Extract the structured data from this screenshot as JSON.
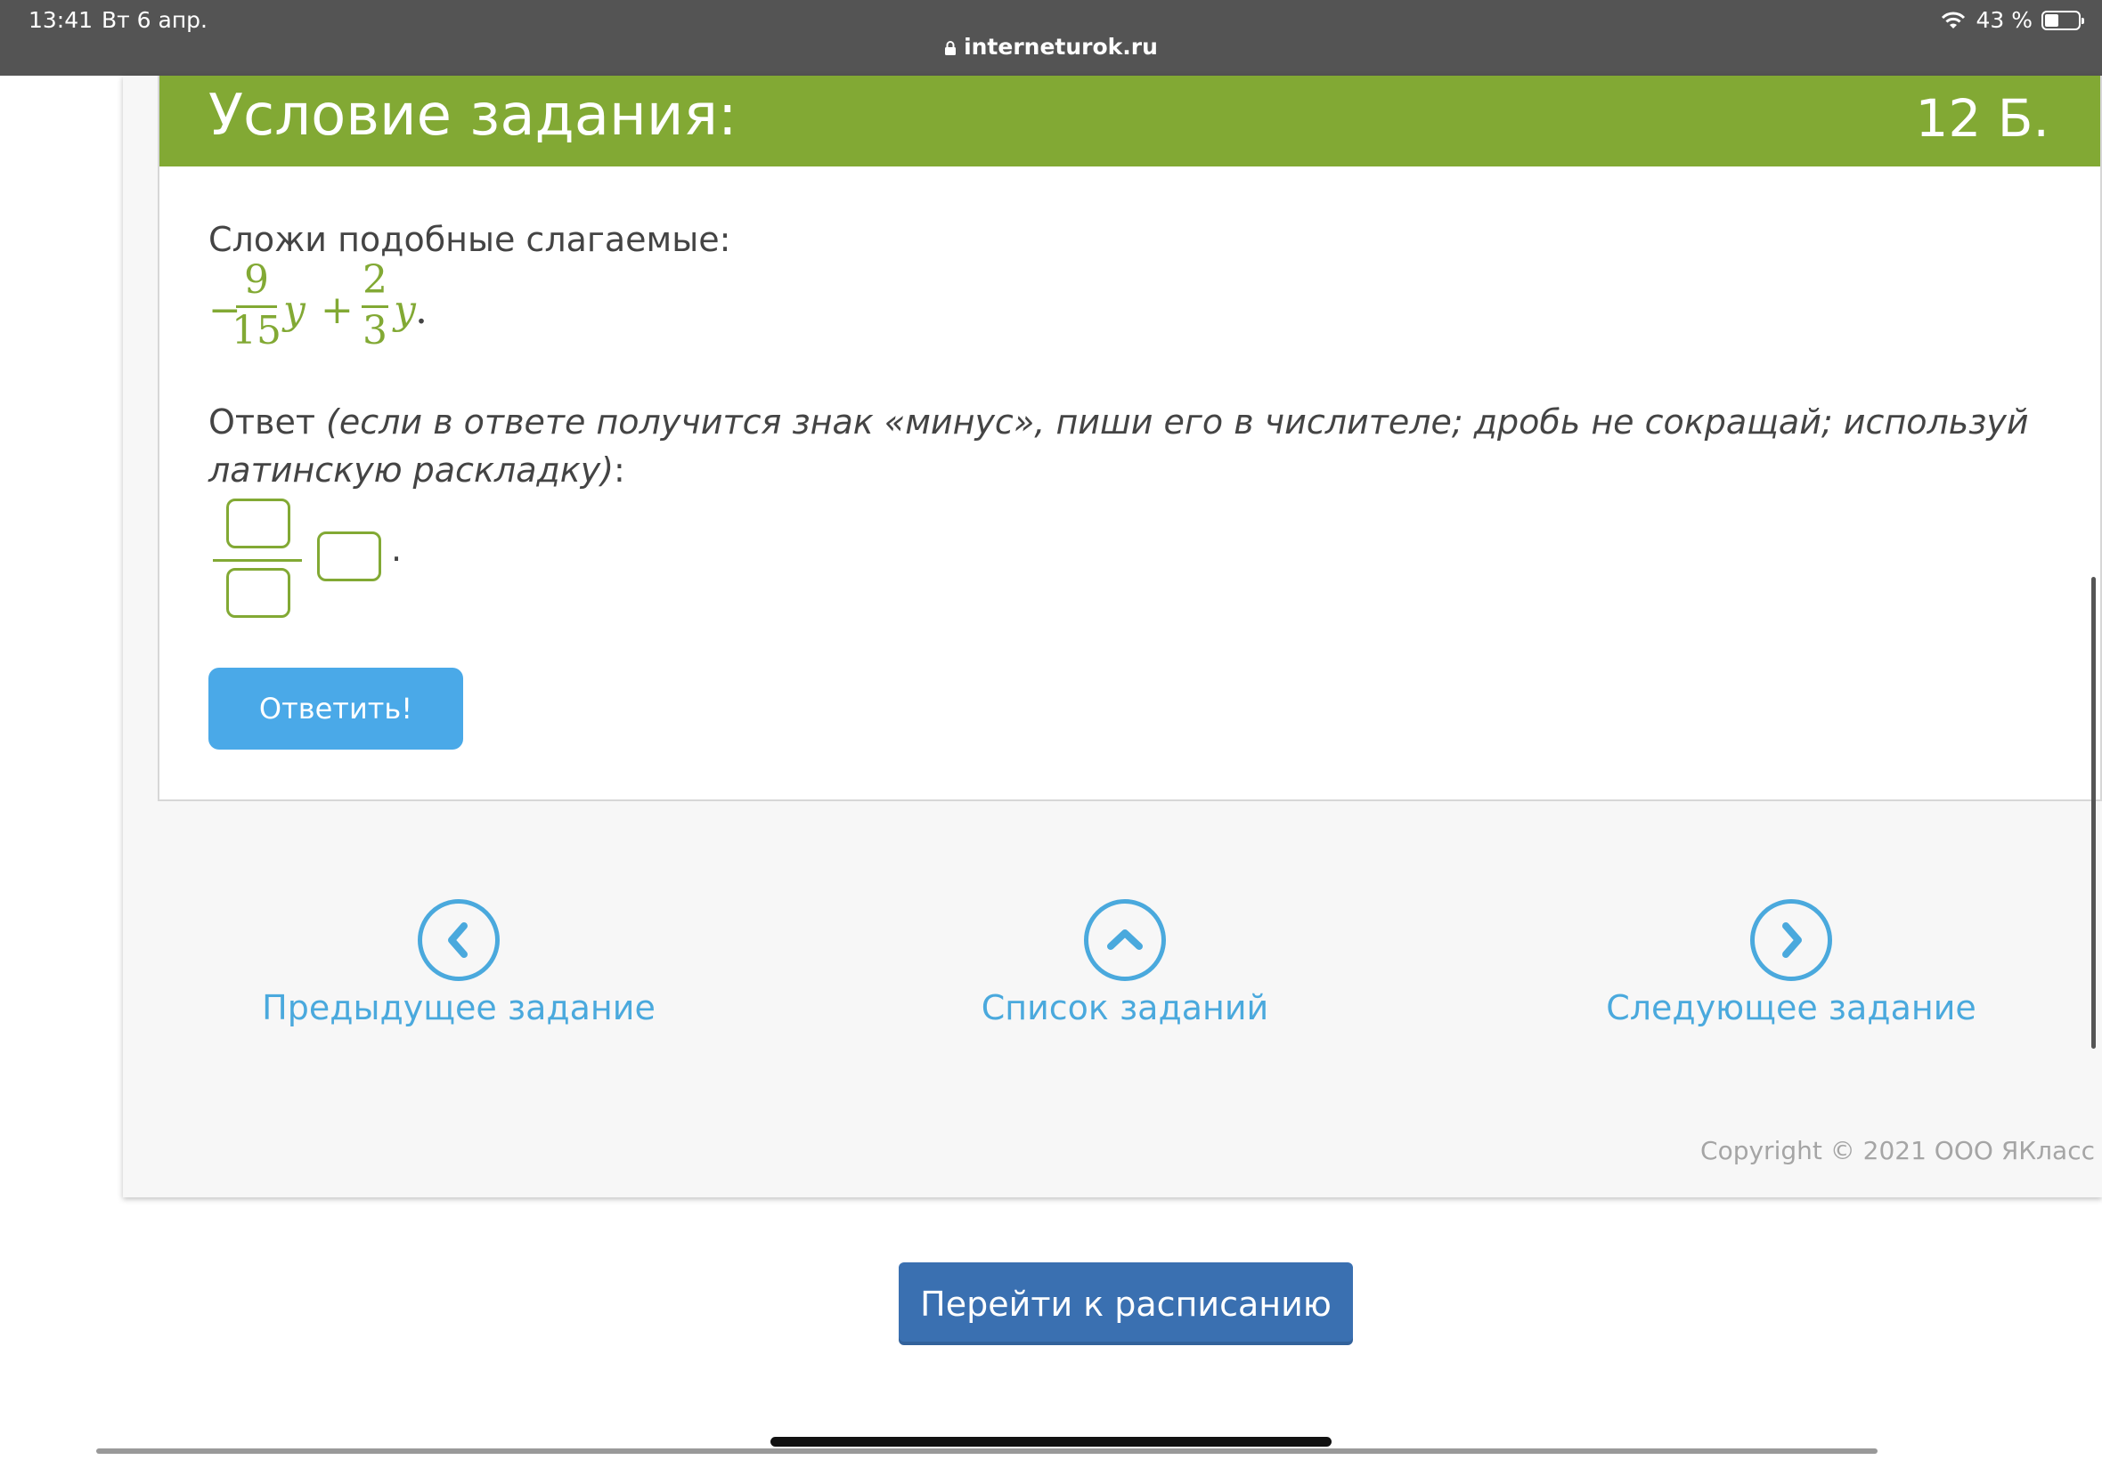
{
  "status_bar": {
    "time": "13:41",
    "date": "Вт 6 апр.",
    "battery_text": "43 %",
    "battery_level": 0.43,
    "url": "interneturok.ru"
  },
  "task": {
    "title": "Условие задания:",
    "score": "12 Б.",
    "prompt": "Сложи подобные слагаемые:",
    "formula": {
      "minus": "−",
      "frac1_num": "9",
      "frac1_den": "15",
      "var1": "y",
      "plus": "+",
      "frac2_num": "2",
      "frac2_den": "3",
      "var2": "y",
      "end": "."
    },
    "answer_label": "Ответ ",
    "answer_hint": "(если в ответе получится знак «минус», пиши его в числителе; дробь не сокращай; используй латинскую раскладку)",
    "answer_colon": ":",
    "answer_dot": ".",
    "inputs": {
      "numerator": "",
      "denominator": "",
      "variable": ""
    },
    "submit_label": "Ответить!"
  },
  "navigation": {
    "prev_label": "Предыдущее задание",
    "list_label": "Список заданий",
    "next_label": "Следующее задание"
  },
  "footer": {
    "copyright": "Copyright © 2021 ООО ЯКласс",
    "schedule_label": "Перейти к расписанию"
  },
  "colors": {
    "accent_green": "#82a934",
    "link_blue": "#4aa9dd",
    "button_blue": "#4aa9e8",
    "schedule_blue": "#3a70b1"
  },
  "icons": [
    "lock-icon",
    "wifi-icon",
    "battery-icon",
    "chevron-left-icon",
    "chevron-up-icon",
    "chevron-right-icon"
  ]
}
